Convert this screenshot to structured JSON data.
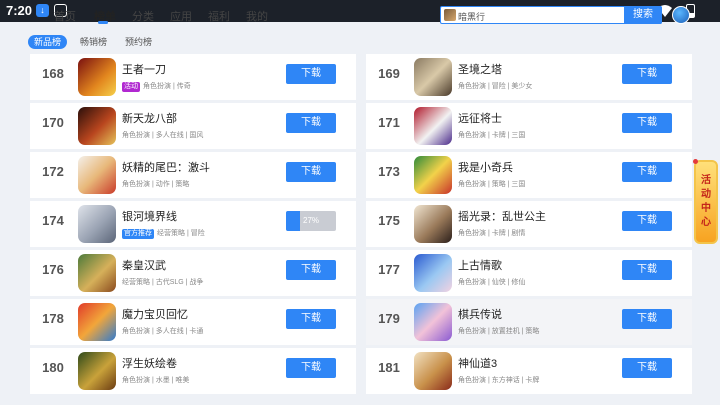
{
  "status_bar": {
    "time": "7:20"
  },
  "nav": {
    "tabs": [
      {
        "label": "首页"
      },
      {
        "label": "榜单"
      },
      {
        "label": "分类"
      },
      {
        "label": "应用"
      },
      {
        "label": "福利"
      },
      {
        "label": "我的"
      }
    ],
    "active": "榜单"
  },
  "search": {
    "placeholder": "暗黑行",
    "button": "搜索"
  },
  "subtabs": [
    {
      "label": "新品榜"
    },
    {
      "label": "畅销榜"
    },
    {
      "label": "预约榜"
    }
  ],
  "apps_left": [
    {
      "rank": "168",
      "name": "王者一刀",
      "badge": "活动",
      "tags": "角色扮演 | 传奇",
      "button": "下载"
    },
    {
      "rank": "170",
      "name": "新天龙八部",
      "tags": "角色扮演 | 多人在线 | 国风",
      "button": "下载"
    },
    {
      "rank": "172",
      "name": "妖精的尾巴：激斗",
      "tags": "角色扮演 | 动作 | 策略",
      "button": "下载"
    },
    {
      "rank": "174",
      "name": "银河境界线",
      "badge": "官方推荐",
      "tags": "经营策略 | 冒险",
      "progress": "27%"
    },
    {
      "rank": "176",
      "name": "秦皇汉武",
      "tags": "经营策略 | 古代SLG | 战争",
      "button": "下载"
    },
    {
      "rank": "178",
      "name": "魔力宝贝回忆",
      "tags": "角色扮演 | 多人在线 | 卡通",
      "button": "下载"
    },
    {
      "rank": "180",
      "name": "浮生妖绘卷",
      "tags": "角色扮演 | 水墨 | 唯美",
      "button": "下载"
    }
  ],
  "apps_right": [
    {
      "rank": "169",
      "name": "圣境之塔",
      "tags": "角色扮演 | 冒险 | 美少女",
      "button": "下载"
    },
    {
      "rank": "171",
      "name": "远征将士",
      "tags": "角色扮演 | 卡牌 | 三国",
      "button": "下载"
    },
    {
      "rank": "173",
      "name": "我是小奇兵",
      "tags": "角色扮演 | 策略 | 三国",
      "button": "下载"
    },
    {
      "rank": "175",
      "name": "摇光录：乱世公主",
      "tags": "角色扮演 | 卡牌 | 剧情",
      "button": "下载"
    },
    {
      "rank": "177",
      "name": "上古情歌",
      "tags": "角色扮演 | 仙侠 | 修仙",
      "button": "下载"
    },
    {
      "rank": "179",
      "name": "棋兵传说",
      "tags": "角色扮演 | 放置挂机 | 策略",
      "button": "下载"
    },
    {
      "rank": "181",
      "name": "神仙道3",
      "tags": "角色扮演 | 东方神话 | 卡牌",
      "button": "下载"
    }
  ],
  "activity": {
    "label": "活动中心"
  },
  "colors": {
    "accent": "#2f86f6",
    "badge_purple": "#b128d1"
  }
}
